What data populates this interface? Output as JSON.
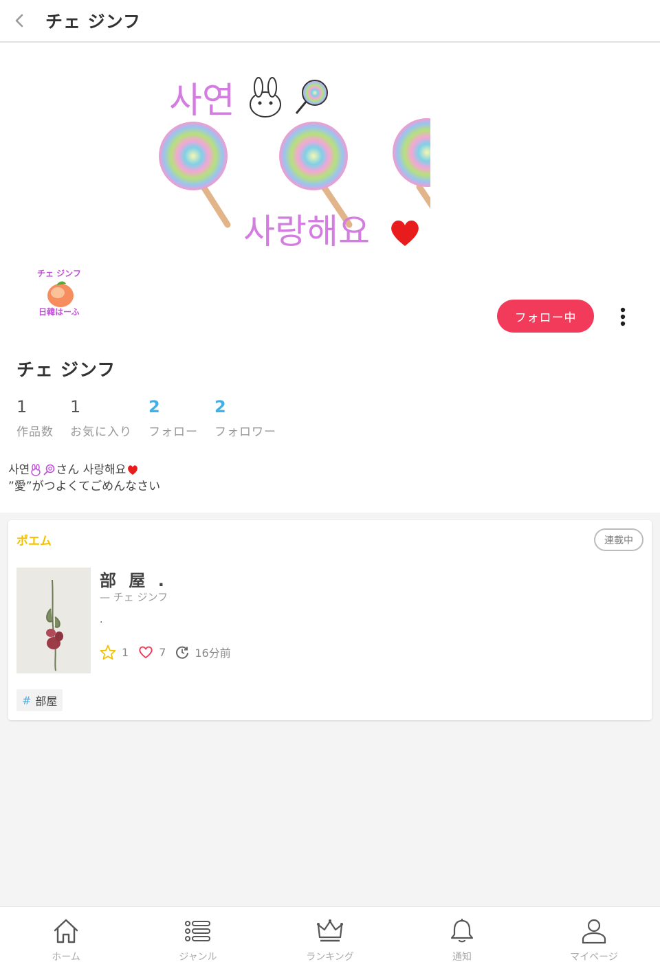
{
  "header": {
    "title": "チェ ジンフ"
  },
  "profile": {
    "follow_button_label": "フォロー中",
    "name": "チェ ジンフ",
    "avatar_text_top": "チェ ジンフ",
    "avatar_text_bottom": "日韓はーふ",
    "banner_text_top": "사연",
    "banner_text_bottom": "사랑해요",
    "stats": [
      {
        "value": "1",
        "label": "作品数"
      },
      {
        "value": "1",
        "label": "お気に入り"
      },
      {
        "value": "2",
        "label": "フォロー"
      },
      {
        "value": "2",
        "label": "フォロワー"
      }
    ],
    "bio_line1_a": "사연",
    "bio_line1_b": "さん 사랑해요",
    "bio_line2": "”愛”がつよくてごめんなさい"
  },
  "work": {
    "genre": "ポエム",
    "status": "連載中",
    "title": "部 屋 .",
    "author": "— チェ ジンフ",
    "description": ".",
    "stars": "1",
    "likes": "7",
    "updated": "16分前",
    "tag": "部屋"
  },
  "nav": {
    "home": "ホーム",
    "genre": "ジャンル",
    "ranking": "ランキング",
    "notifications": "通知",
    "mypage": "マイページ"
  },
  "colors": {
    "accent": "#f23b5a",
    "link_blue": "#3fb0e8",
    "genre_yellow": "#f2c200"
  }
}
